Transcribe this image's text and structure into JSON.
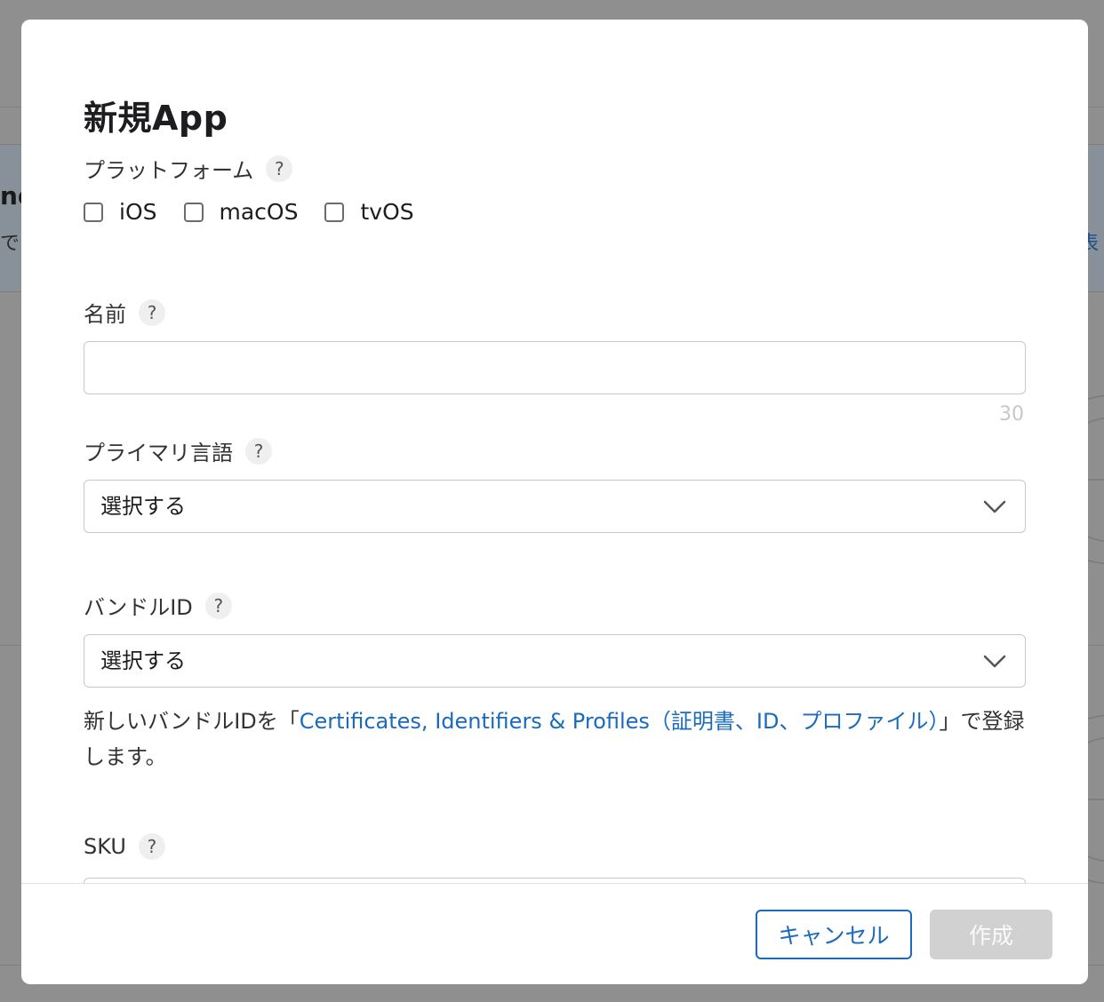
{
  "background": {
    "partial_heading": "nd",
    "partial_text_left": "で",
    "partial_text_right": "表"
  },
  "dialog": {
    "title": "新規App",
    "platform": {
      "label": "プラットフォーム",
      "options": [
        {
          "label": "iOS",
          "checked": false
        },
        {
          "label": "macOS",
          "checked": false
        },
        {
          "label": "tvOS",
          "checked": false
        }
      ]
    },
    "name": {
      "label": "名前",
      "value": "",
      "char_limit": "30"
    },
    "primary_language": {
      "label": "プライマリ言語",
      "selected": "選択する"
    },
    "bundle_id": {
      "label": "バンドルID",
      "selected": "選択する",
      "note_prefix": "新しいバンドルIDを「",
      "note_link": "Certificates, Identifiers & Profiles（証明書、ID、プロファイル）",
      "note_suffix": "」で登録します。"
    },
    "sku": {
      "label": "SKU"
    },
    "help_glyph": "?",
    "buttons": {
      "cancel": "キャンセル",
      "create": "作成"
    }
  },
  "colors": {
    "link": "#1a6bbf",
    "disabled_button": "#d1d1d1",
    "overlay": "#8f8f8f"
  }
}
